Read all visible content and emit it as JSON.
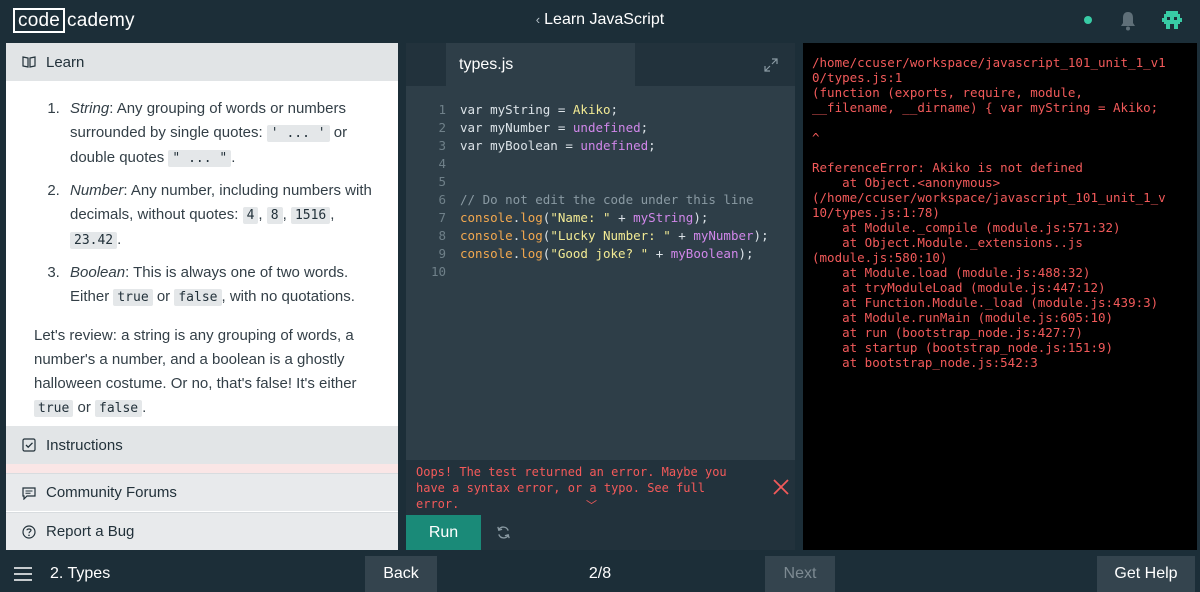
{
  "header": {
    "logo_boxed": "code",
    "logo_rest": "cademy",
    "back_chevron": "‹",
    "course_title": "Learn JavaScript",
    "icons": [
      "status-dot",
      "bell-icon",
      "avatar"
    ]
  },
  "learn": {
    "section_title": "Learn",
    "items": [
      {
        "term": "String",
        "text_a": ": Any grouping of words or numbers surrounded by single quotes: ",
        "code_a": "' ... '",
        "text_b": " or double quotes ",
        "code_b": "\" ... \"",
        "text_c": "."
      },
      {
        "term": "Number",
        "text_a": ": Any number, including numbers with decimals, without quotes: ",
        "codes": [
          "4",
          "8",
          "1516",
          "23.42"
        ],
        "sep": ", ",
        "end": "."
      },
      {
        "term": "Boolean",
        "text_a": ": This is always one of two words. Either ",
        "code_a": "true",
        "text_b": " or ",
        "code_b": "false",
        "text_c": ", with no quotations."
      }
    ],
    "review_text": "Let's review: a string is any grouping of words, a number's a number, and a boolean is a ghostly halloween costume. Or no, that's false! It's either ",
    "review_code_a": "true",
    "review_or": " or ",
    "review_code_b": "false",
    "review_end": "."
  },
  "sections": {
    "instructions": "Instructions",
    "forums": "Community Forums",
    "bug": "Report a Bug"
  },
  "editor": {
    "tab_name": "types.js",
    "lines": [
      {
        "n": "1",
        "parts": [
          [
            "kw",
            "var myString = "
          ],
          [
            "str",
            "Akiko"
          ],
          [
            "kw",
            ";"
          ]
        ]
      },
      {
        "n": "2",
        "parts": [
          [
            "kw",
            "var myNumber = "
          ],
          [
            "und",
            "undefined"
          ],
          [
            "kw",
            ";"
          ]
        ]
      },
      {
        "n": "3",
        "parts": [
          [
            "kw",
            "var myBoolean = "
          ],
          [
            "und",
            "undefined"
          ],
          [
            "kw",
            ";"
          ]
        ]
      },
      {
        "n": "4",
        "parts": []
      },
      {
        "n": "5",
        "parts": []
      },
      {
        "n": "6",
        "parts": [
          [
            "cm",
            "// Do not edit the code under this line"
          ]
        ]
      },
      {
        "n": "7",
        "parts": [
          [
            "fn",
            "console"
          ],
          [
            "kw",
            "."
          ],
          [
            "fn",
            "log"
          ],
          [
            "kw",
            "("
          ],
          [
            "str",
            "\"Name: \""
          ],
          [
            "kw",
            " + "
          ],
          [
            "und",
            "myString"
          ],
          [
            "kw",
            ");"
          ]
        ]
      },
      {
        "n": "8",
        "parts": [
          [
            "fn",
            "console"
          ],
          [
            "kw",
            "."
          ],
          [
            "fn",
            "log"
          ],
          [
            "kw",
            "("
          ],
          [
            "str",
            "\"Lucky Number: \""
          ],
          [
            "kw",
            " + "
          ],
          [
            "und",
            "myNumber"
          ],
          [
            "kw",
            ");"
          ]
        ]
      },
      {
        "n": "9",
        "parts": [
          [
            "fn",
            "console"
          ],
          [
            "kw",
            "."
          ],
          [
            "fn",
            "log"
          ],
          [
            "kw",
            "("
          ],
          [
            "str",
            "\"Good joke? \""
          ],
          [
            "kw",
            " + "
          ],
          [
            "und",
            "myBoolean"
          ],
          [
            "kw",
            ");"
          ]
        ]
      },
      {
        "n": "10",
        "parts": []
      }
    ],
    "error_message": "Oops! The test returned an error. Maybe you have a syntax error, or a typo. See full error.",
    "error_chevron": "﹀",
    "run_label": "Run"
  },
  "console": {
    "output": "/home/ccuser/workspace/javascript_101_unit_1_v1\n0/types.js:1\n(function (exports, require, module,\n__filename, __dirname) { var myString = Akiko;\n\n^\n\nReferenceError: Akiko is not defined\n    at Object.<anonymous>\n(/home/ccuser/workspace/javascript_101_unit_1_v\n10/types.js:1:78)\n    at Module._compile (module.js:571:32)\n    at Object.Module._extensions..js\n(module.js:580:10)\n    at Module.load (module.js:488:32)\n    at tryModuleLoad (module.js:447:12)\n    at Function.Module._load (module.js:439:3)\n    at Module.runMain (module.js:605:10)\n    at run (bootstrap_node.js:427:7)\n    at startup (bootstrap_node.js:151:9)\n    at bootstrap_node.js:542:3"
  },
  "footer": {
    "lesson_name": "2. Types",
    "back_label": "Back",
    "progress": "2/8",
    "next_label": "Next",
    "help_label": "Get Help"
  },
  "colors": {
    "accent": "#1a8a78",
    "error": "#f25a5a",
    "status_dot": "#38cba5",
    "bg_dark": "#1c2e38"
  }
}
